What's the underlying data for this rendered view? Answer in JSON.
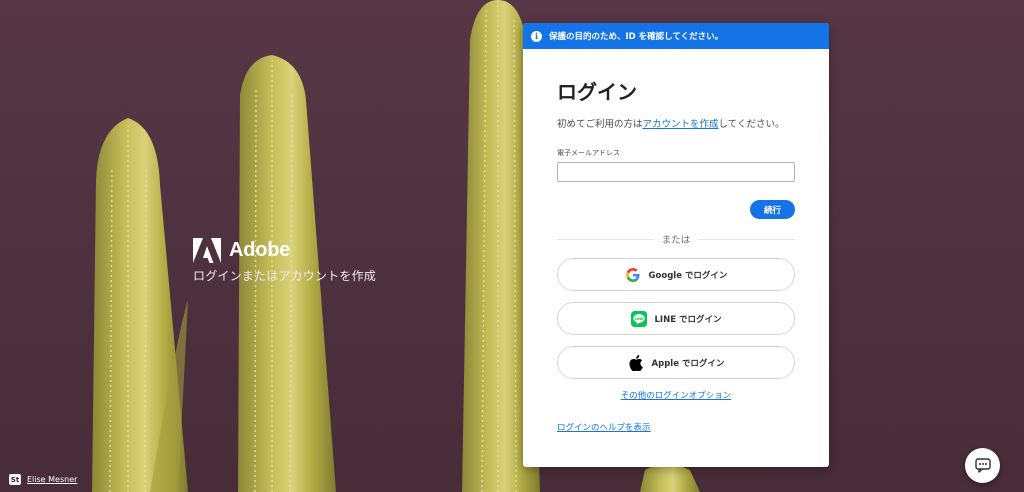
{
  "brand": {
    "name": "Adobe",
    "tagline": "ログインまたはアカウントを作成"
  },
  "photo_credit": {
    "badge": "St",
    "name": "Elise Mesner"
  },
  "banner": {
    "text": "保護の目的のため、ID を確認してください。",
    "icon": "info-icon"
  },
  "login": {
    "title": "ログイン",
    "subtitle_prefix": "初めてご利用の方は",
    "create_account_link": "アカウントを作成",
    "subtitle_suffix": "してください。",
    "email_label": "電子メールアドレス",
    "email_value": "",
    "email_placeholder": "",
    "continue_label": "続行",
    "divider_text": "または",
    "google_label": "Google でログイン",
    "line_label": "LINE でログイン",
    "apple_label": "Apple でログイン",
    "other_options_link": "その他のログインオプション",
    "help_link": "ログインのヘルプを表示"
  },
  "colors": {
    "accent": "#1473e6",
    "background": "#4e313e",
    "cactus": "#b7b14a",
    "line_green": "#06c755"
  },
  "icons": {
    "google": "google-icon",
    "line": "line-icon",
    "apple": "apple-icon",
    "chat": "chat-icon",
    "adobe": "adobe-logo-icon"
  }
}
